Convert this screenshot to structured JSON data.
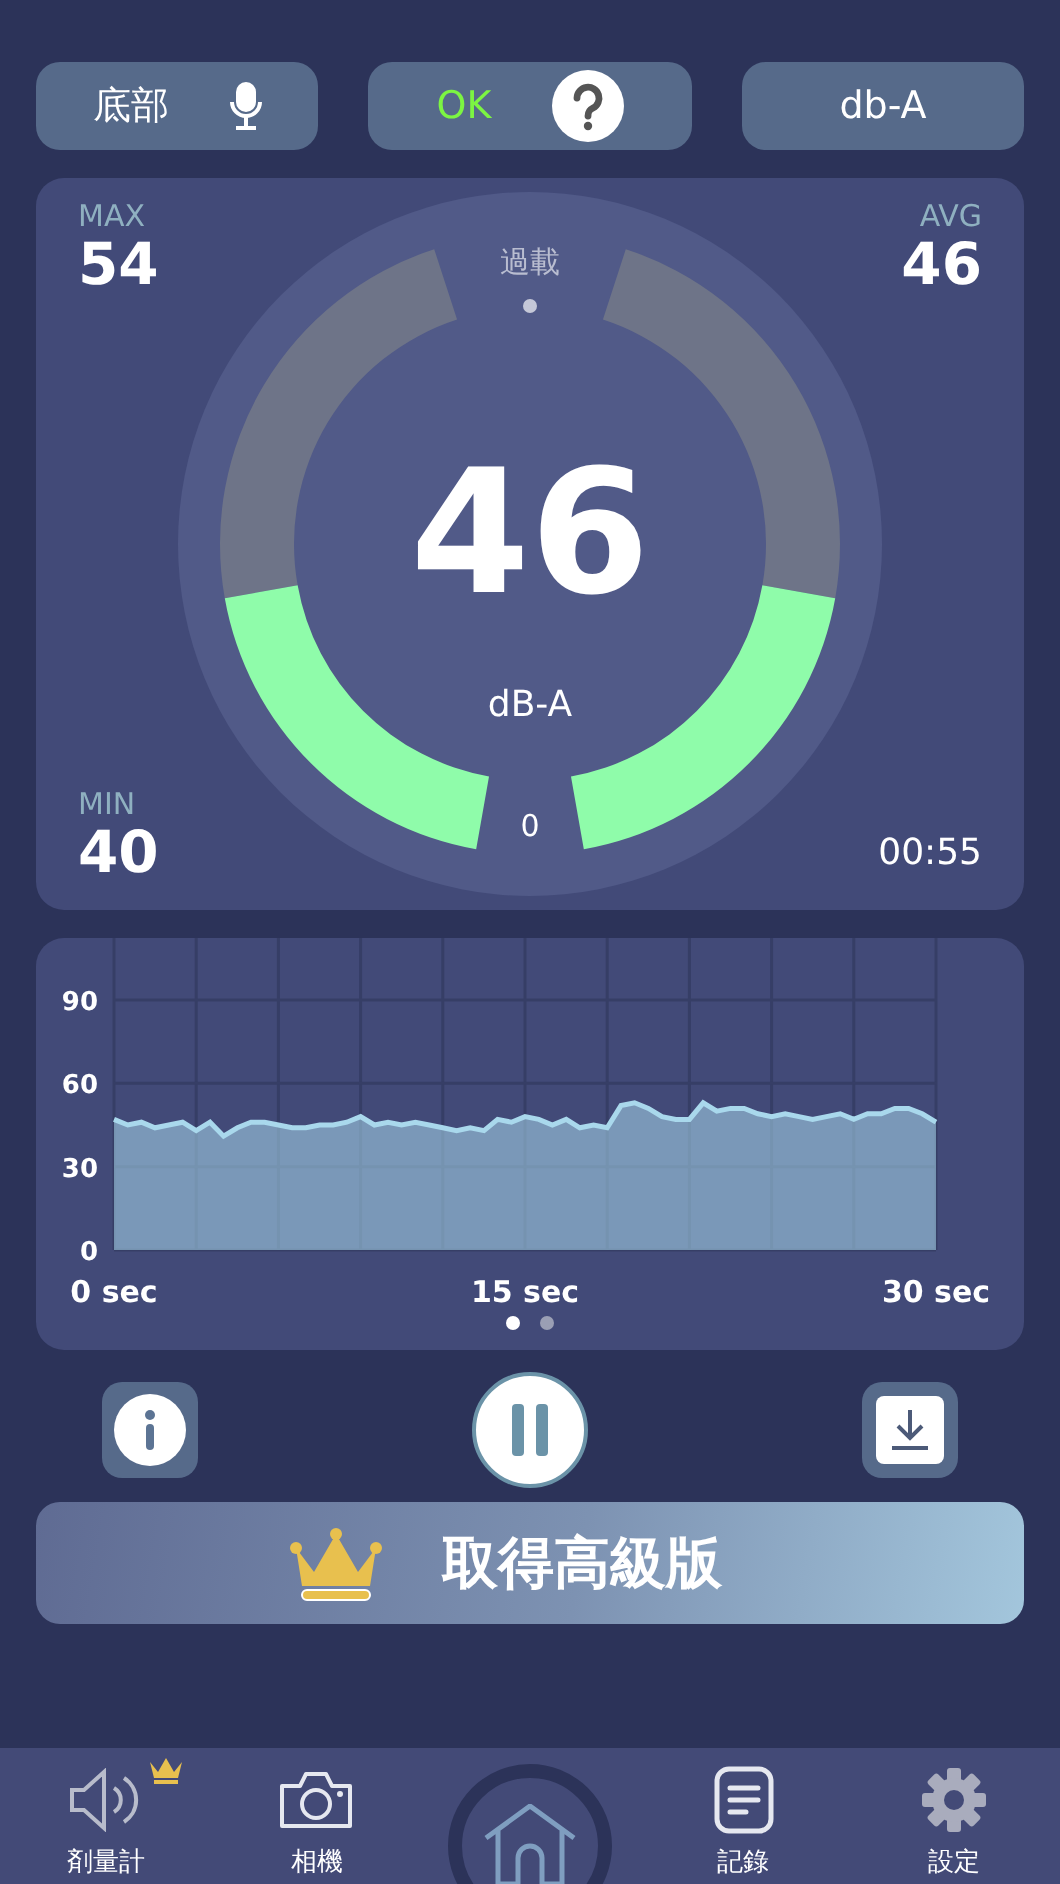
{
  "top_buttons": [
    {
      "kind": "mic",
      "label": "底部"
    },
    {
      "kind": "status",
      "label": "OK"
    },
    {
      "kind": "plain",
      "label": "db-A"
    }
  ],
  "meter": {
    "max_label": "MAX",
    "max": "54",
    "avg_label": "AVG",
    "avg": "46",
    "min_label": "MIN",
    "min": "40",
    "overload_label": "過載",
    "reading": "46",
    "unit": "dB-A",
    "zero_label": "0",
    "elapsed": "00:55",
    "level": 0.46
  },
  "history": {
    "chart_data": {
      "type": "area",
      "x": [
        0,
        0.5,
        1,
        1.5,
        2,
        2.5,
        3,
        3.5,
        4,
        4.5,
        5,
        5.5,
        6,
        6.5,
        7,
        7.5,
        8,
        8.5,
        9,
        9.5,
        10,
        10.5,
        11,
        11.5,
        12,
        12.5,
        13,
        13.5,
        14,
        14.5,
        15,
        15.5,
        16,
        16.5,
        17,
        17.5,
        18,
        18.5,
        19,
        19.5,
        20,
        20.5,
        21,
        21.5,
        22,
        22.5,
        23,
        23.5,
        24,
        24.5,
        25,
        25.5,
        26,
        26.5,
        27,
        27.5,
        28,
        28.5,
        29,
        29.5,
        30
      ],
      "series": [
        {
          "color": "#a9d8ec",
          "values": [
            47,
            45,
            46,
            44,
            45,
            46,
            43,
            46,
            41,
            44,
            46,
            46,
            45,
            44,
            44,
            45,
            45,
            46,
            48,
            45,
            46,
            45,
            46,
            45,
            44,
            43,
            44,
            43,
            47,
            46,
            48,
            47,
            45,
            47,
            44,
            45,
            44,
            52,
            53,
            51,
            48,
            47,
            47,
            53,
            50,
            51,
            51,
            49,
            48,
            49,
            48,
            47,
            48,
            49,
            47,
            49,
            49,
            51,
            51,
            49,
            46
          ]
        }
      ],
      "xlim": [
        0,
        30
      ],
      "grid": true,
      "ylim": [
        0,
        90
      ],
      "xticks": [
        {
          "value": 0,
          "label": "0 sec"
        },
        {
          "value": 15,
          "label": "15 sec"
        },
        {
          "value": 30,
          "label": "30 sec"
        }
      ],
      "yticks": [
        0,
        30,
        60,
        90
      ]
    },
    "pages": [
      {
        "selected": true
      },
      {
        "selected": false
      }
    ]
  },
  "controls": [
    {
      "kind": "info"
    },
    {
      "kind": "pause"
    },
    {
      "kind": "download"
    }
  ],
  "premium_button": {
    "label": "取得高級版"
  },
  "nav": [
    {
      "kind": "meter",
      "label": "剤量計",
      "premium": true
    },
    {
      "kind": "camera",
      "label": "相機",
      "premium": false
    },
    {
      "kind": "home"
    },
    {
      "kind": "log",
      "label": "記錄",
      "premium": false
    },
    {
      "kind": "settings",
      "label": "設定",
      "premium": false
    }
  ]
}
